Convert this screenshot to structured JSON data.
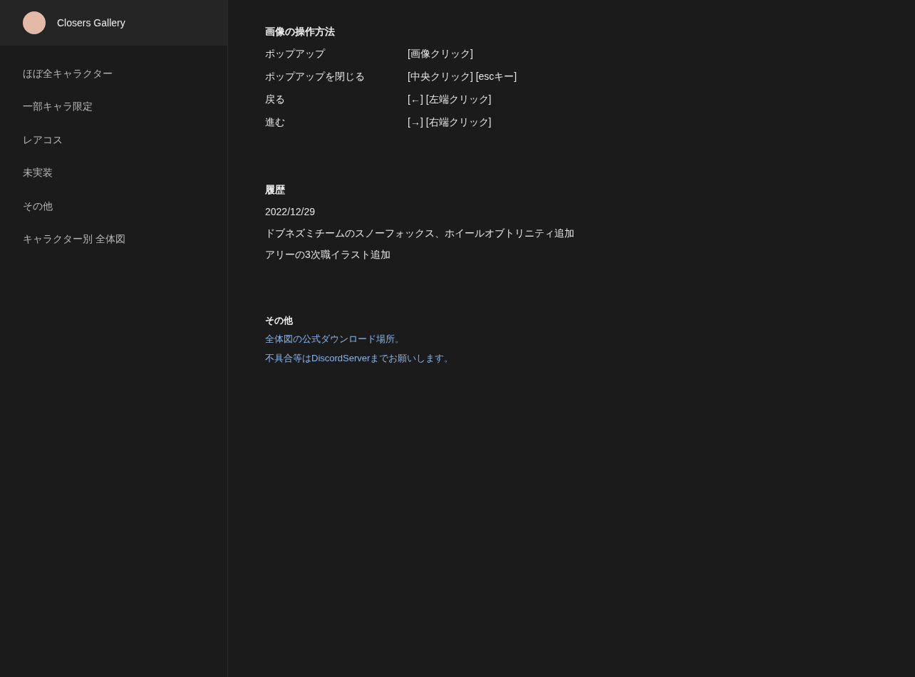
{
  "sidebar": {
    "title": "Closers Gallery",
    "items": [
      {
        "label": "ほぼ全キャラクター"
      },
      {
        "label": "一部キャラ限定"
      },
      {
        "label": "レアコス"
      },
      {
        "label": "未実装"
      },
      {
        "label": "その他"
      },
      {
        "label": "キャラクター別 全体図"
      }
    ]
  },
  "controls": {
    "heading": "画像の操作方法",
    "rows": [
      {
        "action": "ポップアップ",
        "keys": "[画像クリック]"
      },
      {
        "action": "ポップアップを閉じる",
        "keys": "[中央クリック] [escキー]"
      },
      {
        "action": "戻る",
        "keys": "[←] [左端クリック]"
      },
      {
        "action": "進む",
        "keys": "[→] [右端クリック]"
      }
    ]
  },
  "history": {
    "heading": "履歴",
    "lines": [
      "2022/12/29",
      "ドブネズミチームのスノーフォックス、ホイールオブトリニティ追加",
      "アリーの3次職イラスト追加"
    ]
  },
  "other": {
    "heading": "その他",
    "links": [
      "全体図の公式ダウンロード場所。",
      "不具合等はDiscordServerまでお願いします。"
    ]
  }
}
